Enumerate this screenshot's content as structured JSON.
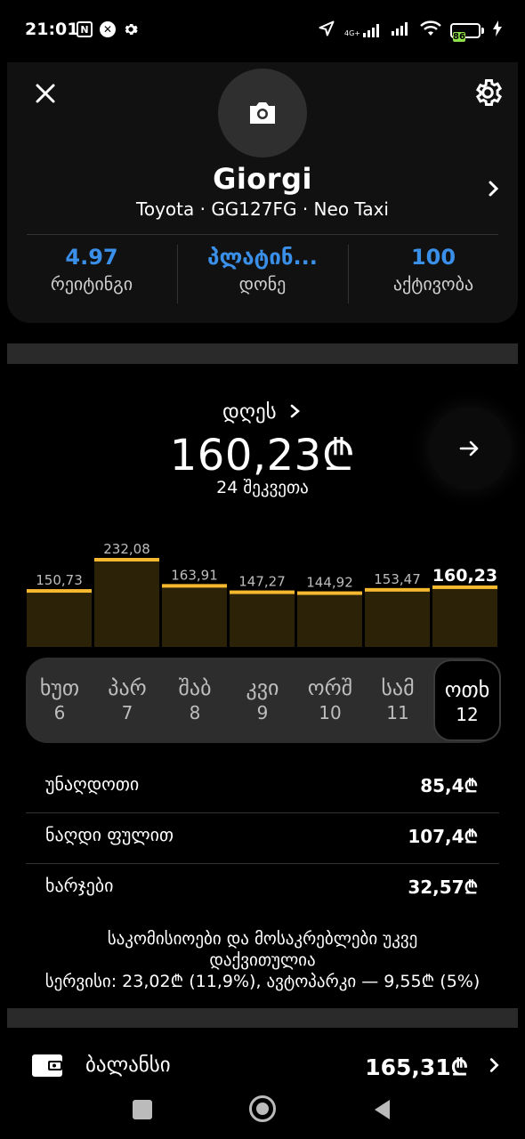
{
  "status_bar": {
    "time": "21:01",
    "network": "4G+",
    "battery": "86",
    "battery_level": 0.86,
    "battery_color": "#8fe04a"
  },
  "profile": {
    "name": "Giorgi",
    "car_line": "Toyota · GG127FG · Neo Taxi",
    "icons": {
      "close": "close-icon",
      "settings": "gear-icon",
      "avatar": "camera-icon",
      "chevron": "chevron-right-icon"
    }
  },
  "stats": [
    {
      "value": "4.97",
      "label": "რეიტინგი"
    },
    {
      "value": "პლატინ...",
      "label": "დონე"
    },
    {
      "value": "100",
      "label": "აქტივობა"
    }
  ],
  "today": {
    "label": "დღეს",
    "amount": "160,23₾",
    "orders": "24 შეკვეთა"
  },
  "chart_data": {
    "type": "bar",
    "categories": [
      "ხუთ 6",
      "პარ 7",
      "შაბ 8",
      "კვი 9",
      "ორშ 10",
      "სამ 11",
      "ოთხ 12"
    ],
    "values": [
      150.73,
      232.08,
      163.91,
      147.27,
      144.92,
      153.47,
      160.23
    ],
    "value_labels": [
      "150,73",
      "232,08",
      "163,91",
      "147,27",
      "144,92",
      "153,47",
      "160,23"
    ],
    "highlight_index": 6,
    "bar_color": "#2c2208",
    "top_color": "#f5b82e"
  },
  "days": [
    {
      "name": "ხუთ",
      "num": "6"
    },
    {
      "name": "პარ",
      "num": "7"
    },
    {
      "name": "შაბ",
      "num": "8"
    },
    {
      "name": "კვი",
      "num": "9"
    },
    {
      "name": "ორშ",
      "num": "10"
    },
    {
      "name": "სამ",
      "num": "11"
    },
    {
      "name": "ოთხ",
      "num": "12"
    }
  ],
  "summary": [
    {
      "label": "უნაღდოთი",
      "value": "85,4₾"
    },
    {
      "label": "ნაღდი ფულით",
      "value": "107,4₾"
    },
    {
      "label": "ხარჯები",
      "value": "32,57₾"
    }
  ],
  "commission_note": {
    "line1": "საკომისიოები და მოსაკრებლები უკვე",
    "line2": "დაქვითულია",
    "line3": "სერვისი: 23,02₾ (11,9%), ავტოპარკი — 9,55₾ (5%)"
  },
  "balance": {
    "label": "ბალანსი",
    "value": "165,31₾",
    "icon": "wallet-icon"
  },
  "colors": {
    "accent_blue": "#3a8fe8",
    "bar_top": "#f5b82e"
  }
}
